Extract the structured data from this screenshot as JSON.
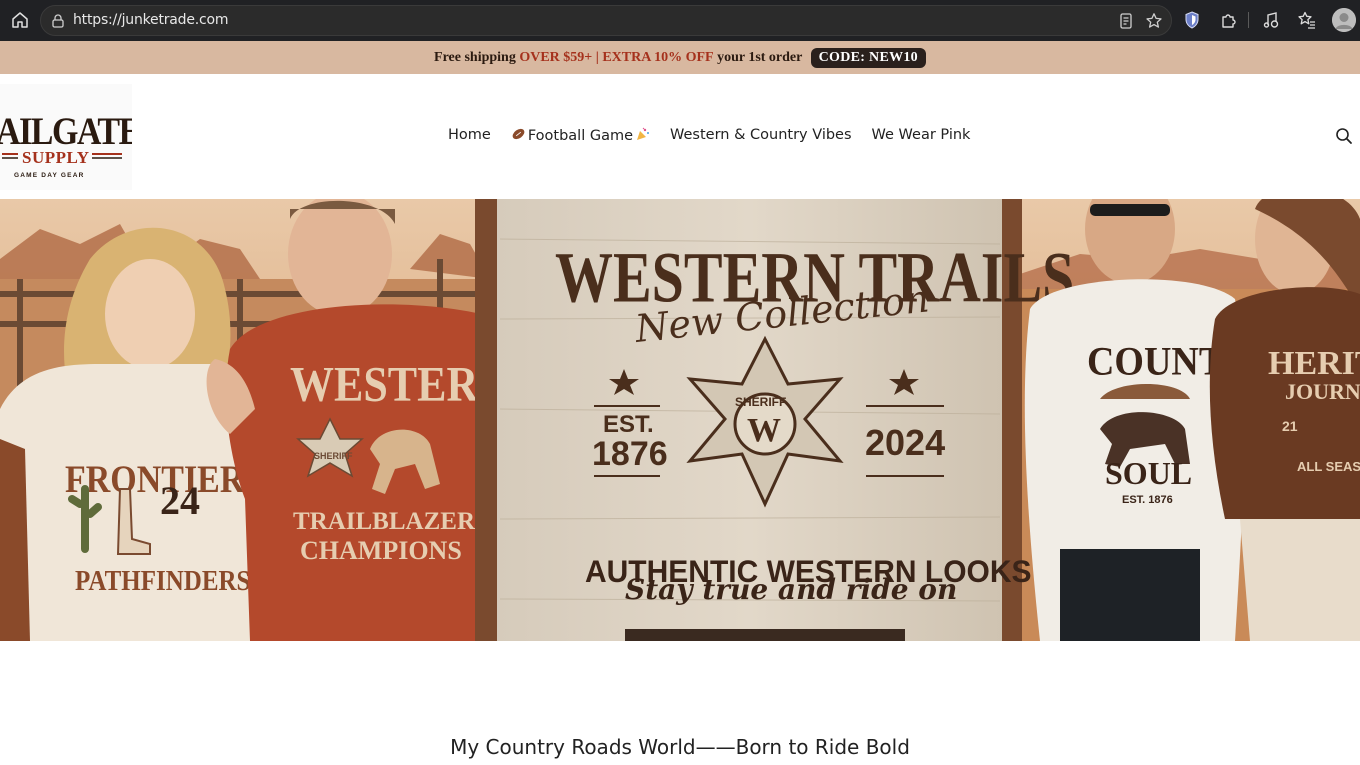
{
  "browser": {
    "url": "https://junketrade.com"
  },
  "promo": {
    "part1": "Free shipping ",
    "part2": "OVER $59+ | EXTRA 10% OFF",
    "part3": " your 1st order ",
    "code": "CODE: NEW10"
  },
  "logo": {
    "line1": "AILGATE",
    "line2": "SUPPLY",
    "line3": "GAME DAY GEAR"
  },
  "nav": {
    "items": [
      {
        "label": "Home"
      },
      {
        "label": "Football Game"
      },
      {
        "label": "Western & Country Vibes"
      },
      {
        "label": "We Wear Pink"
      }
    ]
  },
  "hero": {
    "sign_title": "WESTERN TRAILS",
    "sign_script": "New Collection",
    "est_left": "EST.",
    "year_left": "1876",
    "year_right": "2024",
    "badge_word": "SHERIFF",
    "badge_letter": "W",
    "sign_slogan": "AUTHENTIC WESTERN LOOKS",
    "sign_script2": "Stay true and ride on",
    "shirt1_top": "FRONTIER",
    "shirt1_num": "24",
    "shirt1_bottom": "PATHFINDERS",
    "shirt2_top": "WESTERN",
    "shirt2_badge": "SHERIFF",
    "shirt2_bottom1": "TRAILBLAZERS",
    "shirt2_bottom2": "CHAMPIONS",
    "shirt3_top": "COUNTRY",
    "shirt3_bottom": "SOUL",
    "shirt3_est": "EST. 1876",
    "shirt4_top": "HERITA",
    "shirt4_mid": "JOURN",
    "shirt4_num": "21",
    "shirt4_bottom": "ALL SEAS"
  },
  "tagline": "My Country Roads World——Born to Ride Bold",
  "colors": {
    "promo_bg": "#d8b8a0",
    "promo_accent": "#a5311c",
    "browser_bg": "#202124"
  }
}
